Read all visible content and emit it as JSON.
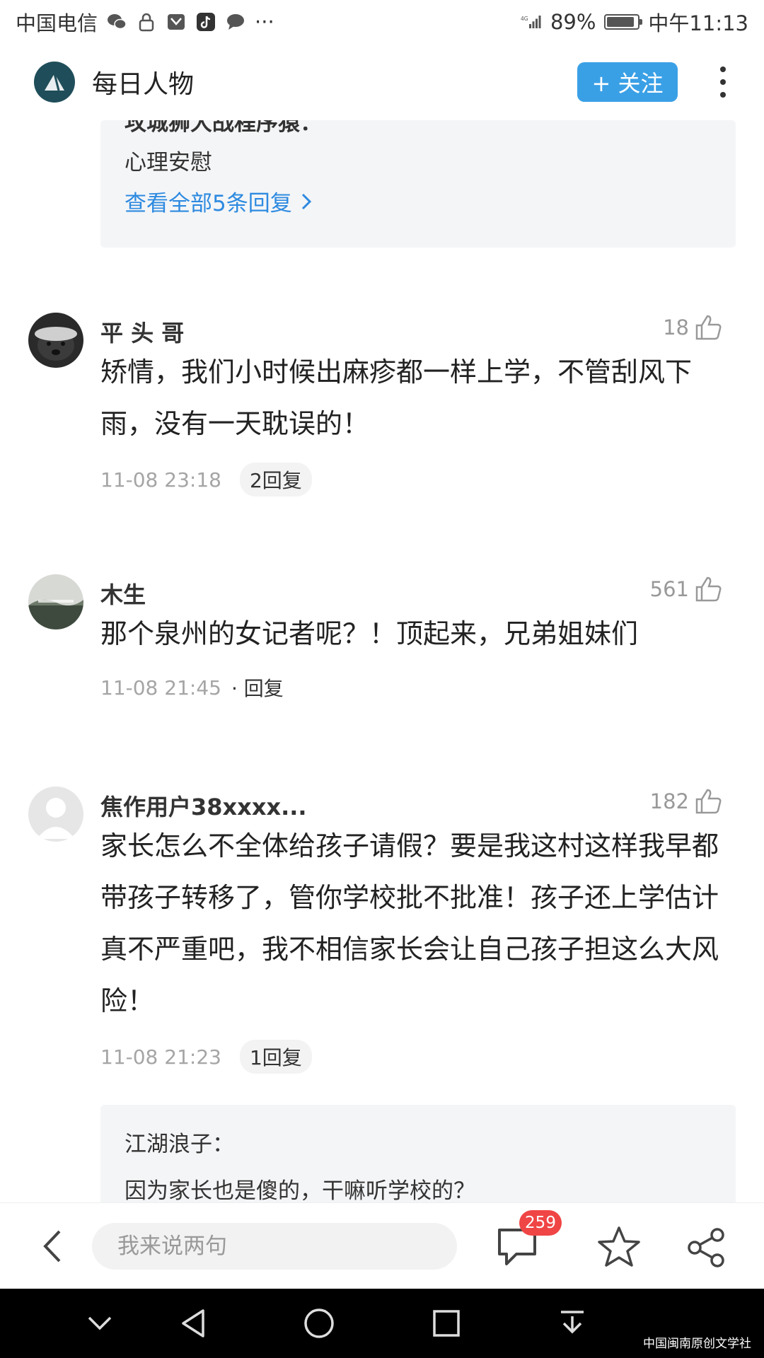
{
  "status_bar": {
    "carrier": "中国电信",
    "signal_type": "4G",
    "battery": "89%",
    "battery_level": 0.89,
    "time": "中午11:13",
    "more": "···"
  },
  "header": {
    "title": "每日人物",
    "follow_label": "+ 关注"
  },
  "reply_thread_1": {
    "partial_line": "攻城狮大战程序猿：",
    "reply_text": "心理安慰",
    "view_all": "查看全部5条回复"
  },
  "comments": [
    {
      "user": "平 头 哥",
      "likes": "18",
      "text": "矫情，我们小时候出麻疹都一样上学，不管刮风下雨，没有一天耽误的！",
      "time": "11-08 23:18",
      "reply": "2回复"
    },
    {
      "user": "木生",
      "likes": "561",
      "text": "那个泉州的女记者呢？！顶起来，兄弟姐妹们",
      "time": "11-08 21:45",
      "reply": "· 回复"
    },
    {
      "user": "焦作用户38xxxx...",
      "likes": "182",
      "text": "家长怎么不全体给孩子请假？要是我这村这样我早都带孩子转移了，管你学校批不批准！孩子还上学估计真不严重吧，我不相信家长会让自己孩子担这么大风险！",
      "time": "11-08 21:23",
      "reply": "1回复"
    }
  ],
  "reply_thread_2": {
    "author": "江湖浪子：",
    "text": "因为家长也是傻的，干嘛听学校的？"
  },
  "bottom_bar": {
    "input_placeholder": "我来说两句",
    "comment_count": "259"
  },
  "watermark": "中国闽南原创文学社",
  "colors": {
    "accent": "#3aa0e6",
    "link": "#2d8ae0",
    "badge": "#f04545"
  }
}
